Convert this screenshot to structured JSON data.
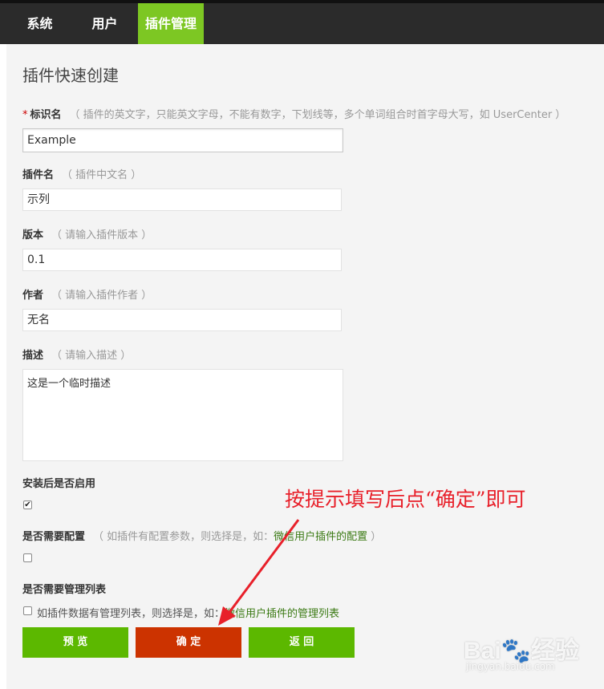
{
  "nav": {
    "items": [
      {
        "label": "系统"
      },
      {
        "label": "用户"
      },
      {
        "label": "插件管理"
      }
    ]
  },
  "page": {
    "title": "插件快速创建"
  },
  "form": {
    "identifier": {
      "required_mark": "*",
      "label": "标识名",
      "hint": "（ 插件的英文字，只能英文字母，不能有数字，下划线等，多个单词组合时首字母大写，如 UserCenter ）",
      "value": "Example"
    },
    "name": {
      "label": "插件名",
      "hint": "（ 插件中文名 ）",
      "value": "示列"
    },
    "version": {
      "label": "版本",
      "hint": "（ 请输入插件版本 ）",
      "value": "0.1"
    },
    "author": {
      "label": "作者",
      "hint": "（ 请输入插件作者 ）",
      "value": "无名"
    },
    "description": {
      "label": "描述",
      "hint": "（ 请输入描述 ）",
      "value": "这是一个临时描述"
    },
    "enable_after_install": {
      "label": "安装后是否启用",
      "checked": true
    },
    "needs_config": {
      "label": "是否需要配置",
      "hint_prefix": "（ 如插件有配置参数，则选择是，如：",
      "hint_link": "微信用户插件的配置",
      "hint_suffix": " ）",
      "checked": false
    },
    "needs_admin_list": {
      "label": "是否需要管理列表",
      "option_text": "如插件数据有管理列表，则选择是，如：",
      "option_link": "微信用户插件的管理列表",
      "checked": false
    }
  },
  "buttons": {
    "preview": "预 览",
    "confirm": "确 定",
    "back": "返 回"
  },
  "annotation": {
    "text": "按提示填写后点“确定”即可",
    "color": "#e8202a"
  },
  "watermark": {
    "brand": "Bai🐾经验",
    "url": "jingyan.baidu.com"
  },
  "colors": {
    "nav_bg": "#2b2b2b",
    "nav_active": "#7dc723",
    "btn_green": "#5cb800",
    "btn_red": "#cc3300"
  }
}
